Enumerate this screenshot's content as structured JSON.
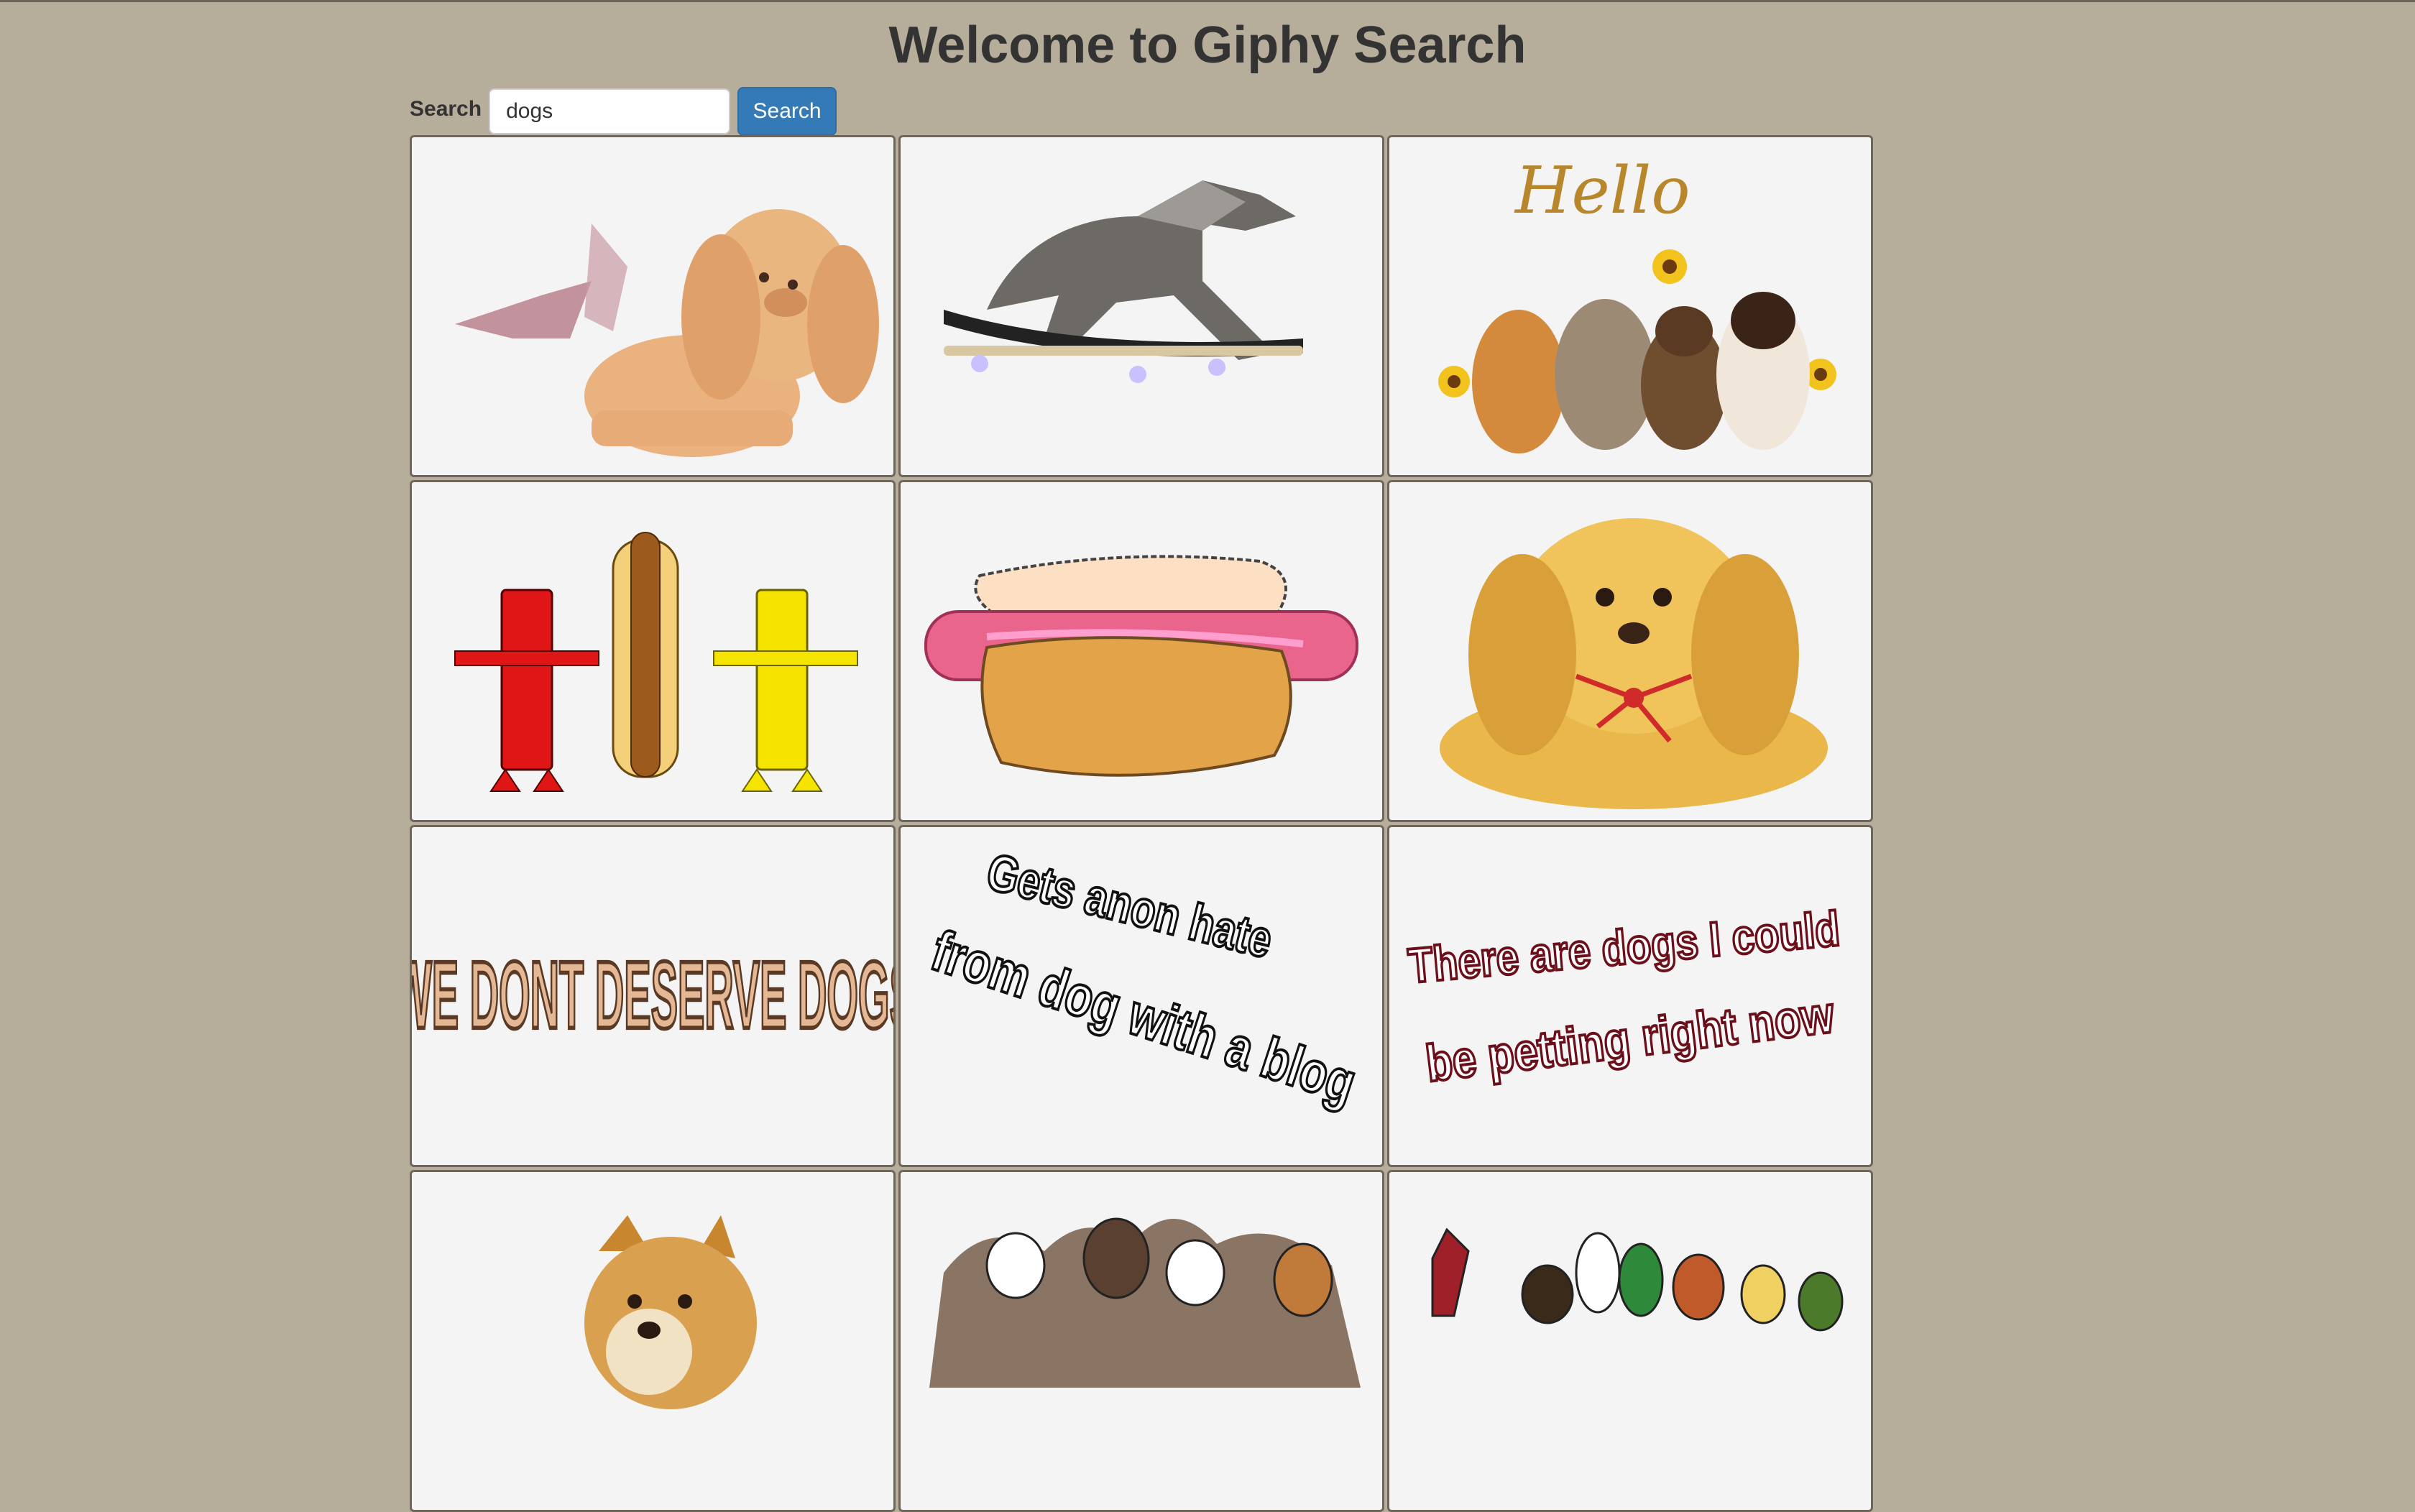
{
  "page": {
    "title": "Welcome to Giphy Search"
  },
  "search": {
    "label": "Search",
    "value": "dogs",
    "button_label": "Search"
  },
  "results": [
    {
      "name": "gif-winged-spaniel"
    },
    {
      "name": "gif-skateboarding-dog"
    },
    {
      "name": "gif-hello-puppies",
      "text": "Hello"
    },
    {
      "name": "gif-hydrant-hotdog-dance"
    },
    {
      "name": "gif-hotdog-bun"
    },
    {
      "name": "gif-golden-puppy-ribbon"
    },
    {
      "name": "gif-we-dont-deserve-dogs",
      "text": "WE DONT DESERVE DOGS"
    },
    {
      "name": "gif-anon-hate-text",
      "text_line1": "Gets anon hate",
      "text_line2": "from dog with a blog"
    },
    {
      "name": "gif-dogs-petting-text",
      "text_line1": "There are dogs I could",
      "text_line2": "be petting right now"
    },
    {
      "name": "gif-doge"
    },
    {
      "name": "gif-dog-crowd-1"
    },
    {
      "name": "gif-dog-crowd-2"
    }
  ],
  "colors": {
    "background": "#b6ae9b",
    "tile_background": "#f4f4f4",
    "button": "#337ab7"
  }
}
